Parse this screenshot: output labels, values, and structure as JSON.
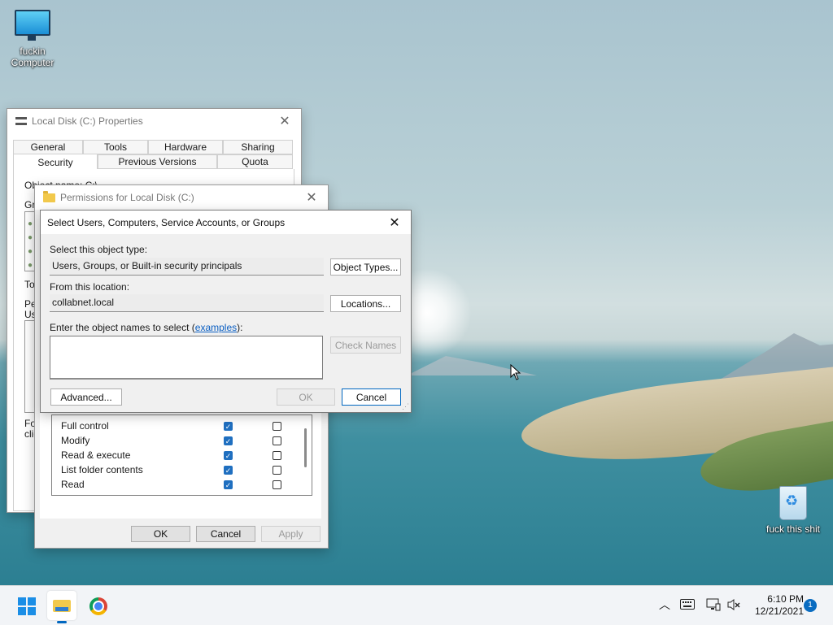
{
  "desktop": {
    "icons": [
      {
        "label_1": "fuckin",
        "label_2": "Computer",
        "icon": "monitor-icon"
      },
      {
        "label": "fuck this shit",
        "icon": "recycle-bin-icon"
      }
    ]
  },
  "properties_window": {
    "title": "Local Disk (C:) Properties",
    "tabs_row1": [
      "General",
      "Tools",
      "Hardware",
      "Sharing"
    ],
    "tabs_row2": [
      "Security",
      "Previous Versions",
      "Quota"
    ],
    "partial_labels": [
      "Object name:",
      "C:\\",
      "Gr",
      "To",
      "Pe",
      "Us",
      "Fo",
      "clic"
    ]
  },
  "permissions_window": {
    "title": "Permissions for Local Disk (C:)",
    "permissions": [
      {
        "name": "Full control",
        "allow": true,
        "deny": false
      },
      {
        "name": "Modify",
        "allow": true,
        "deny": false
      },
      {
        "name": "Read & execute",
        "allow": true,
        "deny": false
      },
      {
        "name": "List folder contents",
        "allow": true,
        "deny": false
      },
      {
        "name": "Read",
        "allow": true,
        "deny": false
      }
    ],
    "ok_label": "OK",
    "cancel_label": "Cancel",
    "apply_label": "Apply"
  },
  "select_dialog": {
    "title": "Select Users, Computers, Service Accounts, or Groups",
    "object_type_label": "Select this object type:",
    "object_type_value": "Users, Groups, or Built-in security principals",
    "object_types_button": "Object Types...",
    "location_label": "From this location:",
    "location_value": "collabnet.local",
    "locations_button": "Locations...",
    "names_label_prefix": "Enter the object names to select (",
    "names_label_link": "examples",
    "names_label_suffix": "):",
    "names_value": "",
    "check_names_button": "Check Names",
    "advanced_button": "Advanced...",
    "ok_button": "OK",
    "cancel_button": "Cancel"
  },
  "taskbar": {
    "time": "6:10 PM",
    "date": "12/21/2021",
    "notification_count": "1",
    "icons": [
      "windows-start-icon",
      "file-explorer-icon",
      "chrome-icon"
    ],
    "tray_icons": [
      "chevron-up-icon",
      "keyboard-icon",
      "network-icon",
      "volume-muted-icon"
    ]
  }
}
